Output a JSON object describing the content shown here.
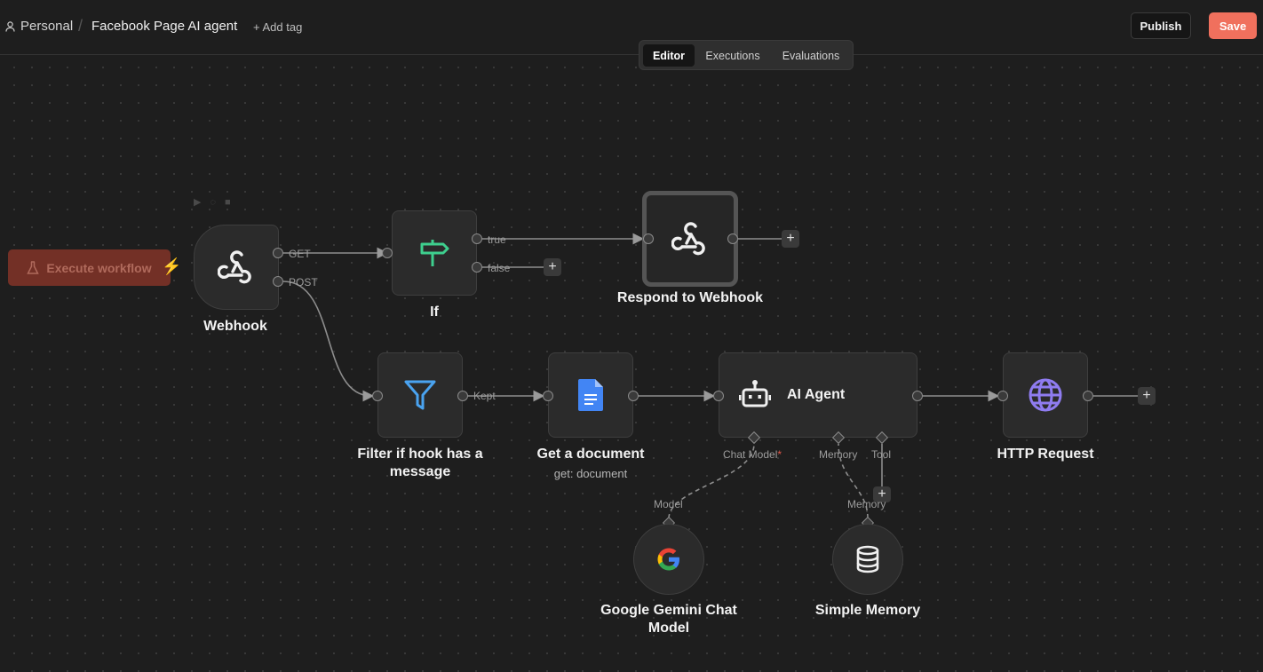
{
  "header": {
    "breadcrumb_personal": "Personal",
    "separator": "/",
    "workflow_title": "Facebook Page AI agent",
    "add_tag": "+ Add tag",
    "publish_label": "Publish",
    "save_label": "Save"
  },
  "tabs": [
    {
      "label": "Editor",
      "active": true
    },
    {
      "label": "Executions",
      "active": false
    },
    {
      "label": "Evaluations",
      "active": false
    }
  ],
  "execute_button": {
    "label": "Execute workflow",
    "icon": "flask-icon"
  },
  "nodes": {
    "webhook": {
      "label": "Webhook",
      "icon": "webhook-icon",
      "outputs": [
        "GET",
        "POST"
      ]
    },
    "if": {
      "label": "If",
      "icon": "signpost-icon",
      "outputs": [
        "true",
        "false"
      ]
    },
    "respond": {
      "label": "Respond to Webhook",
      "icon": "webhook-icon"
    },
    "filter": {
      "label": "Filter if hook has a message",
      "icon": "filter-icon",
      "outputs": [
        "Kept"
      ]
    },
    "get_document": {
      "label": "Get a document",
      "subtitle": "get: document",
      "icon": "google-docs-icon"
    },
    "ai_agent": {
      "label": "AI Agent",
      "icon": "robot-icon",
      "inputs": [
        "Chat Model",
        "Memory",
        "Tool"
      ],
      "required_marker": "*"
    },
    "http_request": {
      "label": "HTTP Request",
      "icon": "globe-icon"
    },
    "gemini": {
      "label": "Google Gemini Chat Model",
      "icon": "google-icon",
      "output": "Model"
    },
    "memory": {
      "label": "Simple Memory",
      "icon": "database-icon",
      "output": "Memory"
    }
  },
  "colors": {
    "save": "#f0705d",
    "if_icon": "#3ecf8e",
    "filter_icon": "#4aa3f0",
    "docs_icon": "#4285f4",
    "globe_icon": "#8f7cf0",
    "execute_bg": "#733026"
  }
}
